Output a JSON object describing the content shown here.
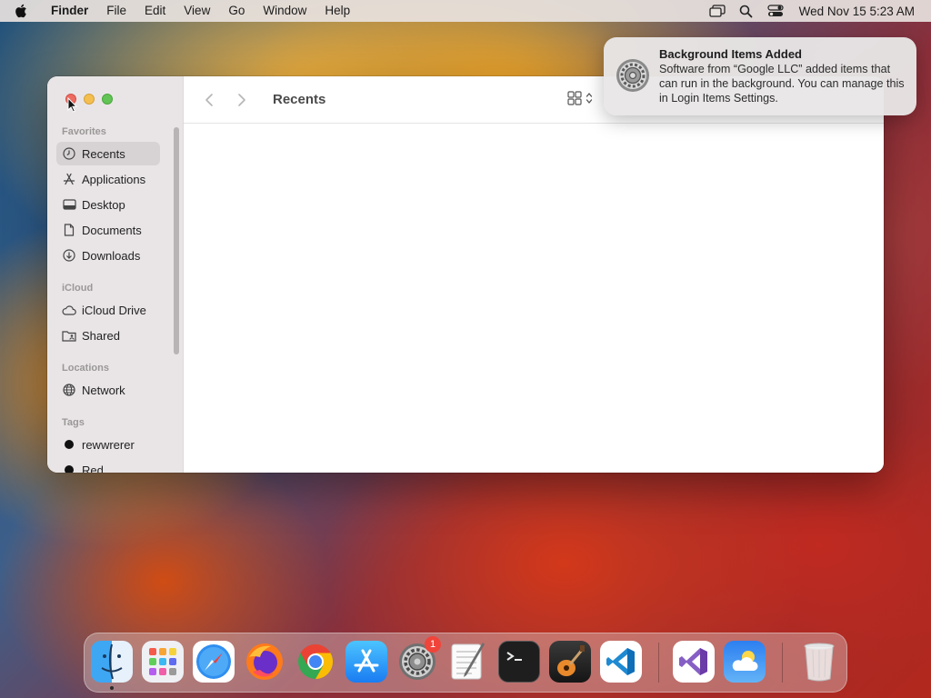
{
  "menubar": {
    "app_name": "Finder",
    "menus": [
      "File",
      "Edit",
      "View",
      "Go",
      "Window",
      "Help"
    ],
    "clock": "Wed Nov 15  5:23 AM"
  },
  "finder": {
    "title": "Recents",
    "sidebar": {
      "favorites_label": "Favorites",
      "favorites": [
        "Recents",
        "Applications",
        "Desktop",
        "Documents",
        "Downloads"
      ],
      "icloud_label": "iCloud",
      "icloud": [
        "iCloud Drive",
        "Shared"
      ],
      "locations_label": "Locations",
      "locations": [
        "Network"
      ],
      "tags_label": "Tags",
      "tags": [
        "rewwrerer",
        "Red"
      ]
    }
  },
  "notification": {
    "title": "Background Items Added",
    "body": "Software from “Google LLC” added items that can run in the background. You can manage this in Login Items Settings."
  },
  "dock": {
    "apps": [
      "Finder",
      "Launchpad",
      "Safari",
      "Firefox",
      "Google Chrome",
      "App Store",
      "System Settings",
      "TextEdit",
      "Terminal",
      "GarageBand",
      "Visual Studio Code",
      "Visual Studio",
      "Weather",
      "Trash"
    ],
    "settings_badge": "1"
  },
  "colors": {
    "close": "#ed6a5e",
    "minimize": "#f5bf4f",
    "maximize": "#61c454",
    "badge": "#f0443a"
  }
}
